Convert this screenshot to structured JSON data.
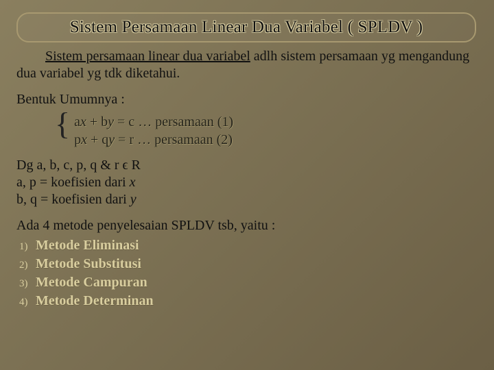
{
  "title": "Sistem Persamaan Linear Dua Variabel ( SPLDV )",
  "intro": {
    "prefix_underlined": "Sistem persamaan linear dua variabel",
    "rest": " adlh sistem persamaan yg mengandung dua variabel yg tdk diketahui."
  },
  "bentuk_label": "Bentuk Umumnya :",
  "equations": {
    "eq1": {
      "a": "a",
      "x": "x",
      "plus": " + b",
      "y": "y",
      "tail": " = c … persamaan (1)"
    },
    "eq2": {
      "a": "p",
      "x": "x",
      "plus": " + q",
      "y": "y",
      "tail": " = r … persamaan (2)"
    }
  },
  "notes": {
    "line1_pre": "Dg a, b, c, p, q & r ",
    "line1_sym": "ϵ",
    "line1_post": " R",
    "line2_pre": "a, p = koefisien dari ",
    "line2_var": "x",
    "line3_pre": "b, q = koefisien dari ",
    "line3_var": "y"
  },
  "methods_intro": "Ada 4 metode penyelesaian SPLDV tsb, yaitu :",
  "methods": [
    {
      "n": "1)",
      "name": "Metode Eliminasi"
    },
    {
      "n": "2)",
      "name": "Metode Substitusi"
    },
    {
      "n": "3)",
      "name": "Metode Campuran"
    },
    {
      "n": "4)",
      "name": "Metode Determinan"
    }
  ]
}
